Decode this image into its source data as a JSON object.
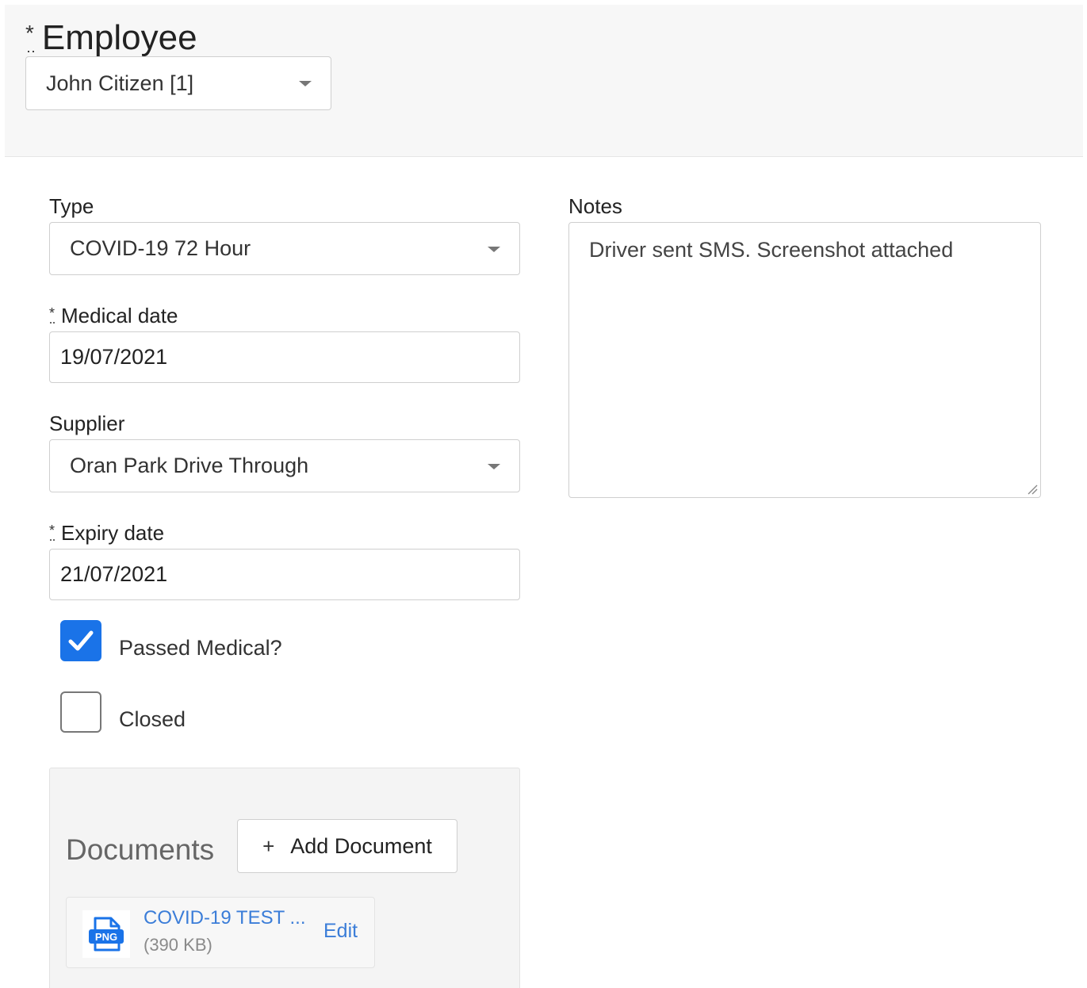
{
  "employee": {
    "required_mark": "*",
    "label": "Employee",
    "selected": "John Citizen [1]"
  },
  "form": {
    "type": {
      "label": "Type",
      "selected": "COVID-19 72 Hour"
    },
    "medical_date": {
      "required_mark": "*",
      "label": "Medical date",
      "value": "19/07/2021"
    },
    "supplier": {
      "label": "Supplier",
      "selected": "Oran Park Drive Through"
    },
    "expiry_date": {
      "required_mark": "*",
      "label": "Expiry date",
      "value": "21/07/2021"
    },
    "passed_medical": {
      "label": "Passed Medical?",
      "checked": true
    },
    "closed": {
      "label": "Closed",
      "checked": false
    },
    "notes": {
      "label": "Notes",
      "value": "Driver sent SMS. Screenshot attached"
    }
  },
  "documents": {
    "title": "Documents",
    "add_icon": "+",
    "add_label": "Add Document",
    "items": [
      {
        "file_type": "PNG",
        "name": "COVID-19 TEST ...",
        "size": "(390 KB)",
        "edit_label": "Edit"
      }
    ]
  },
  "colors": {
    "accent": "#1a73e8",
    "link": "#3b7dd8",
    "header_bg": "#f7f7f7",
    "panel_bg": "#f4f4f4"
  }
}
